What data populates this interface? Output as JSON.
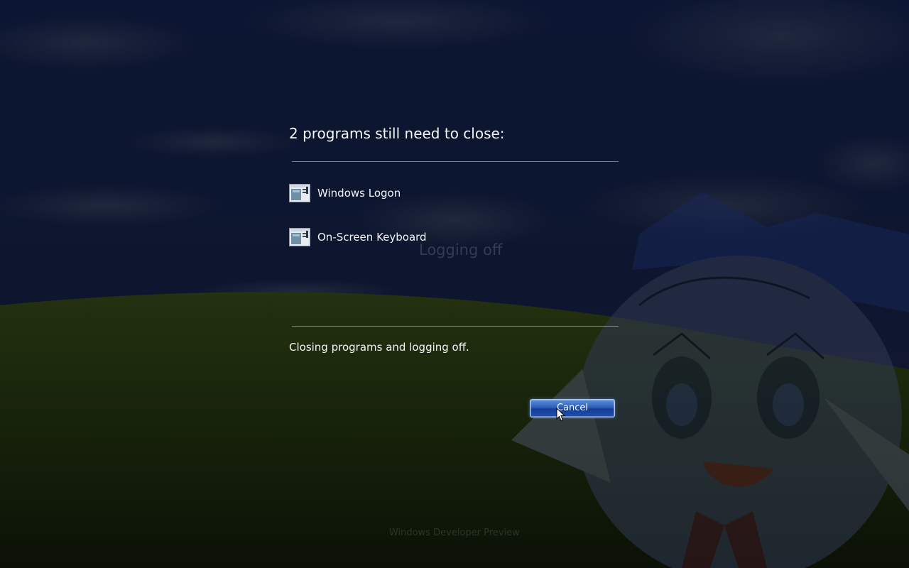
{
  "dialog": {
    "title": "2 programs still need to close:",
    "programs": [
      {
        "label": "Windows Logon",
        "icon": "application-window-icon"
      },
      {
        "label": "On-Screen Keyboard",
        "icon": "application-window-icon"
      }
    ],
    "status": "Closing programs and logging off.",
    "cancel_label": "Cancel"
  },
  "background": {
    "logging_off_text": "Logging off",
    "watermark_text": "Windows Developer Preview"
  },
  "colors": {
    "sky": "#0d1633",
    "hill": "#2f4a0c",
    "button_accent": "#2d5fb9"
  }
}
